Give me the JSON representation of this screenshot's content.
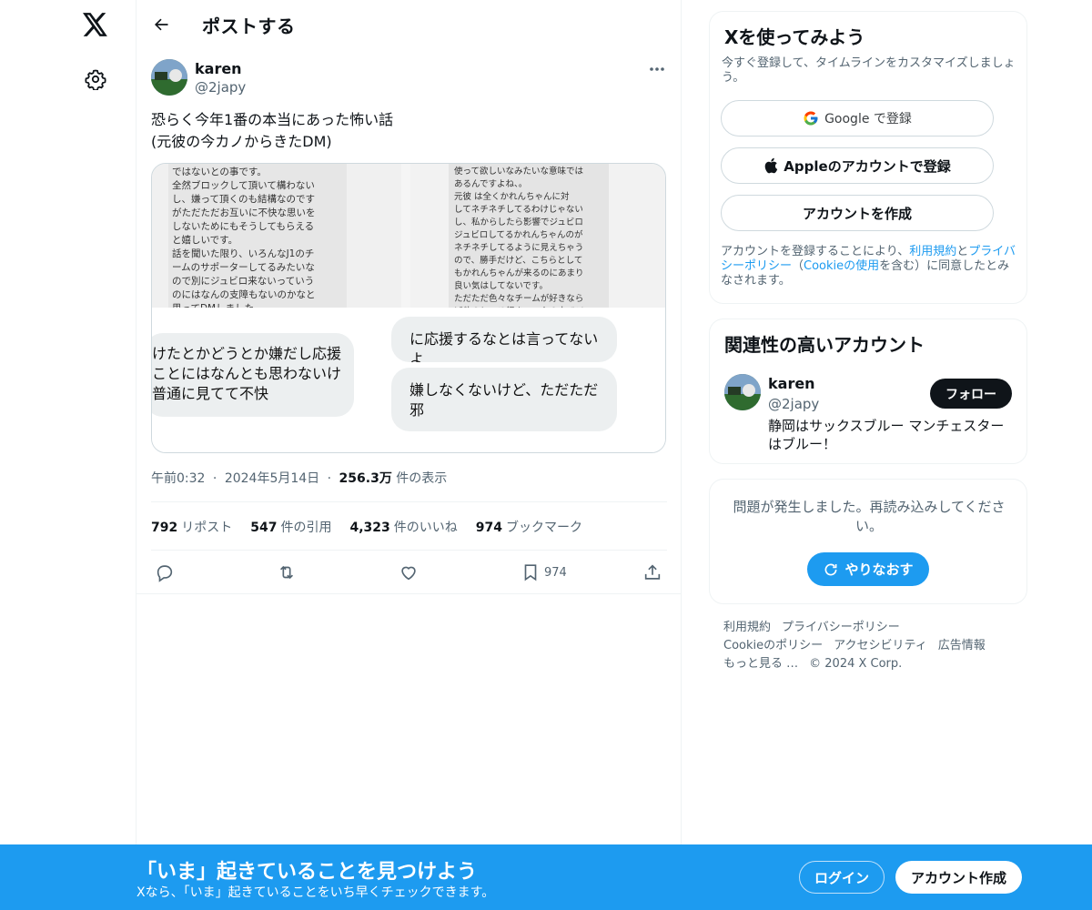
{
  "header": {
    "title": "ポストする"
  },
  "tweet": {
    "author_name": "karen",
    "author_handle": "@2japy",
    "text": "恐らく今年1番の本当にあった怖い話\n(元彼の今カノからきたDM)",
    "media": {
      "top_left_text": "ではないとの事です。\n全然ブロックして頂いて構わない\nし、嫌って頂くのも結構なのです\nがただただお互いに不快な思いを\nしないためにもそうしてもらえる\nと嬉しいです。\n話を聞いた限り、いろんなJ1のチ\nームのサポーターしてるみたいな\nので別にジュビロ来ないっていう\nのにはなんの支障もないのかなと\n思ってDMしました。",
      "top_right_text": "使って欲しいなみたいな意味では\nあるんですよね、。\n元彼  は全くかれんちゃんに対\nしてネチネチしてるわけじゃない\nし、私からしたら影響でジュビロ\nジュビロしてるかれんちゃんのが\nネチネチしてるように見えちゃう\nので、勝手だけど、こちらとして\nもかれんちゃんが来るのにあまり\n良い気はしてないです。\nただただ色々なチームが好きなら\nば他のところ行きつつ心の中でジ",
      "bottom_left_bubble": "けたとかどうとか嫌だし応援\nことにはなんとも思わないけ\n普通に見てて不快",
      "bottom_right_bubble_1": "に応援するなとは言ってないよ",
      "bottom_right_bubble_2": "嫌しなくないけど、ただただ邪"
    },
    "time": "午前0:32",
    "date": "2024年5月14日",
    "views_value": "256.3万",
    "views_label": "件の表示",
    "sep": "·",
    "stats": {
      "reposts_value": "792",
      "reposts_label": "リポスト",
      "quotes_value": "547",
      "quotes_label": "件の引用",
      "likes_value": "4,323",
      "likes_label": "件のいいね",
      "bookmarks_value": "974",
      "bookmarks_label": "ブックマーク"
    },
    "bookmark_count": "974"
  },
  "signup_card": {
    "title": "Xを使ってみよう",
    "subtitle": "今すぐ登録して、タイムラインをカスタマイズしましょう。",
    "google_label": "Google で登録",
    "apple_label": "Appleのアカウントで登録",
    "create_label": "アカウントを作成",
    "legal_1": "アカウントを登録することにより、",
    "legal_terms": "利用規約",
    "legal_2": "と",
    "legal_privacy": "プライバシーポリシー",
    "legal_3": "（",
    "legal_cookie": "Cookieの使用",
    "legal_4": "を含む）に同意したとみなされます。"
  },
  "related": {
    "title": "関連性の高いアカウント",
    "name": "karen",
    "handle": "@2japy",
    "bio": "静岡はサックスブルー マンチェスターはブルー！",
    "follow_label": "フォロー"
  },
  "error_card": {
    "message": "問題が発生しました。再読み込みしてください。",
    "retry_label": "やりなおす"
  },
  "footer": {
    "terms": "利用規約",
    "privacy": "プライバシーポリシー",
    "cookie": "Cookieのポリシー",
    "accessibility": "アクセシビリティ",
    "ads": "広告情報",
    "more": "もっと見る …",
    "copyright": "© 2024 X Corp."
  },
  "banner": {
    "headline": "「いま」起きていることを見つけよう",
    "sub": "Xなら、「いま」起きていることをいち早くチェックできます。",
    "login_label": "ログイン",
    "signup_label": "アカウント作成"
  },
  "icons": {
    "logo": "x-logo-icon",
    "settings": "gear-icon",
    "back": "arrow-left-icon",
    "more": "more-horizontal-icon",
    "reply": "reply-icon",
    "repost": "repost-icon",
    "like": "heart-icon",
    "bookmark": "bookmark-icon",
    "share": "share-icon",
    "google": "google-icon",
    "apple": "apple-icon",
    "refresh": "refresh-icon"
  },
  "colors": {
    "accent": "#1d9bf0",
    "text": "#0f1419",
    "muted": "#536471"
  }
}
